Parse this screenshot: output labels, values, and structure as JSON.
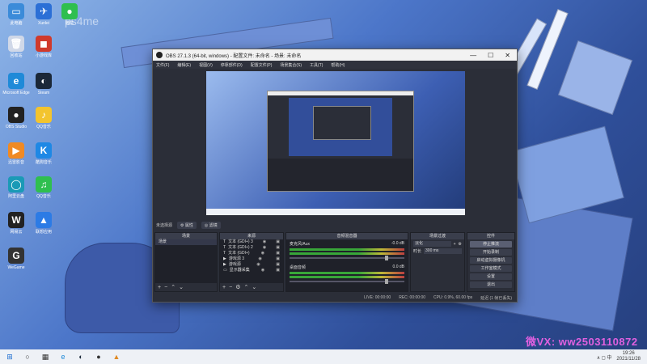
{
  "watermark_top": "ps4me",
  "desktop_icons": [
    {
      "label": "此电脑",
      "glyph": "▭",
      "color": "#3b8bd9"
    },
    {
      "label": "Xunlei",
      "glyph": "✈",
      "color": "#2b6fd6"
    },
    {
      "label": "微信",
      "glyph": "●",
      "color": "#2fbf4f"
    },
    {
      "label": "回收站",
      "glyph": "🗑",
      "color": "#d0d8e8"
    },
    {
      "label": "小游戏库",
      "glyph": "◼",
      "color": "#d03a2c"
    },
    {
      "label": "Microsoft Edge",
      "glyph": "e",
      "color": "#1f8ad8"
    },
    {
      "label": "Steam",
      "glyph": "◐",
      "color": "#1b2838"
    },
    {
      "label": "OBS Studio",
      "glyph": "●",
      "color": "#222"
    },
    {
      "label": "QQ音乐",
      "glyph": "♪",
      "color": "#f3c42e"
    },
    {
      "label": "迅雷影音",
      "glyph": "▶",
      "color": "#f08a24"
    },
    {
      "label": "酷狗音乐",
      "glyph": "K",
      "color": "#1e88e5"
    },
    {
      "label": "阿里云盘",
      "glyph": "◯",
      "color": "#1a9ab6"
    },
    {
      "label": "QQ音乐",
      "glyph": "♫",
      "color": "#2fbf4f"
    },
    {
      "label": "网易云",
      "glyph": "W",
      "color": "#222"
    },
    {
      "label": "联想应用",
      "glyph": "▲",
      "color": "#2c7be5"
    },
    {
      "label": "WeGame",
      "glyph": "G",
      "color": "#333"
    }
  ],
  "obs": {
    "title": "OBS 27.1.3 (64-bit, windows) - 配置文件: 未命名 - 场景: 未命名",
    "menu": [
      "文件(F)",
      "编辑(E)",
      "视图(V)",
      "停靠部件(D)",
      "配置文件(P)",
      "场景集合(S)",
      "工具(T)",
      "帮助(H)"
    ],
    "preview_watermark": "ps4me",
    "scene_bar": {
      "label": "未选择源",
      "btn1": "属性",
      "btn2": "滤镜"
    },
    "docks": {
      "scenes": {
        "title": "场景",
        "items": [
          "场景"
        ]
      },
      "sources": {
        "title": "来源",
        "items": [
          "文本 (GDI+) 3",
          "文本 (GDI+) 2",
          "文本 (GDI+)",
          "游戏源 3",
          "游戏源",
          "显示器采集"
        ]
      },
      "mixer": {
        "title": "音频混音器",
        "tracks": [
          {
            "name": "麦克风/Aux",
            "db": "-0.0 dB"
          },
          {
            "name": "桌面音频",
            "db": "0.0 dB"
          }
        ]
      },
      "transitions": {
        "title": "场景过渡",
        "type": "淡化",
        "duration_label": "时长",
        "duration": "300 ms"
      },
      "controls": {
        "title": "控件",
        "buttons": [
          "停止推流",
          "开始录制",
          "启动虚拟摄像机",
          "工作室模式",
          "设置",
          "退出"
        ]
      }
    },
    "status": {
      "live": "LIVE: 00:00:00",
      "rec": "REC: 00:00:00",
      "cpu": "CPU: 0.9%, 60.00 fps",
      "extra": "延迟 (1 帧已丢失)"
    }
  },
  "pink_watermark": "微VX: ww2503110872",
  "taskbar": {
    "icons": [
      "⊞",
      "○",
      "▦",
      "e",
      "◐",
      "●",
      "▲"
    ],
    "time": "19:26",
    "date": "2021/11/28",
    "tray": "∧ ◻ 中"
  }
}
